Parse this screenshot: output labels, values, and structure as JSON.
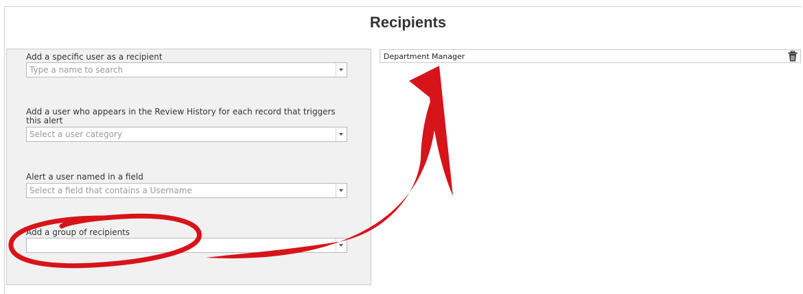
{
  "page": {
    "title": "Recipients"
  },
  "left_panel": {
    "specific_user": {
      "label": "Add a specific user as a recipient",
      "placeholder": "Type a name to search"
    },
    "review_history_user": {
      "label": "Add a user who appears in the Review History for each record that triggers this alert",
      "placeholder": "Select a user category"
    },
    "field_user": {
      "label": "Alert a user named in a field",
      "placeholder": "Select a field that contains a Username"
    },
    "group": {
      "label": "Add a group of recipients",
      "placeholder": ""
    }
  },
  "recipients": [
    {
      "name": "Department Manager",
      "action_icon": "trash-icon"
    }
  ],
  "annotation": {
    "color": "#d7141a",
    "shapes": [
      "highlight-ellipse",
      "curved-arrow"
    ]
  }
}
